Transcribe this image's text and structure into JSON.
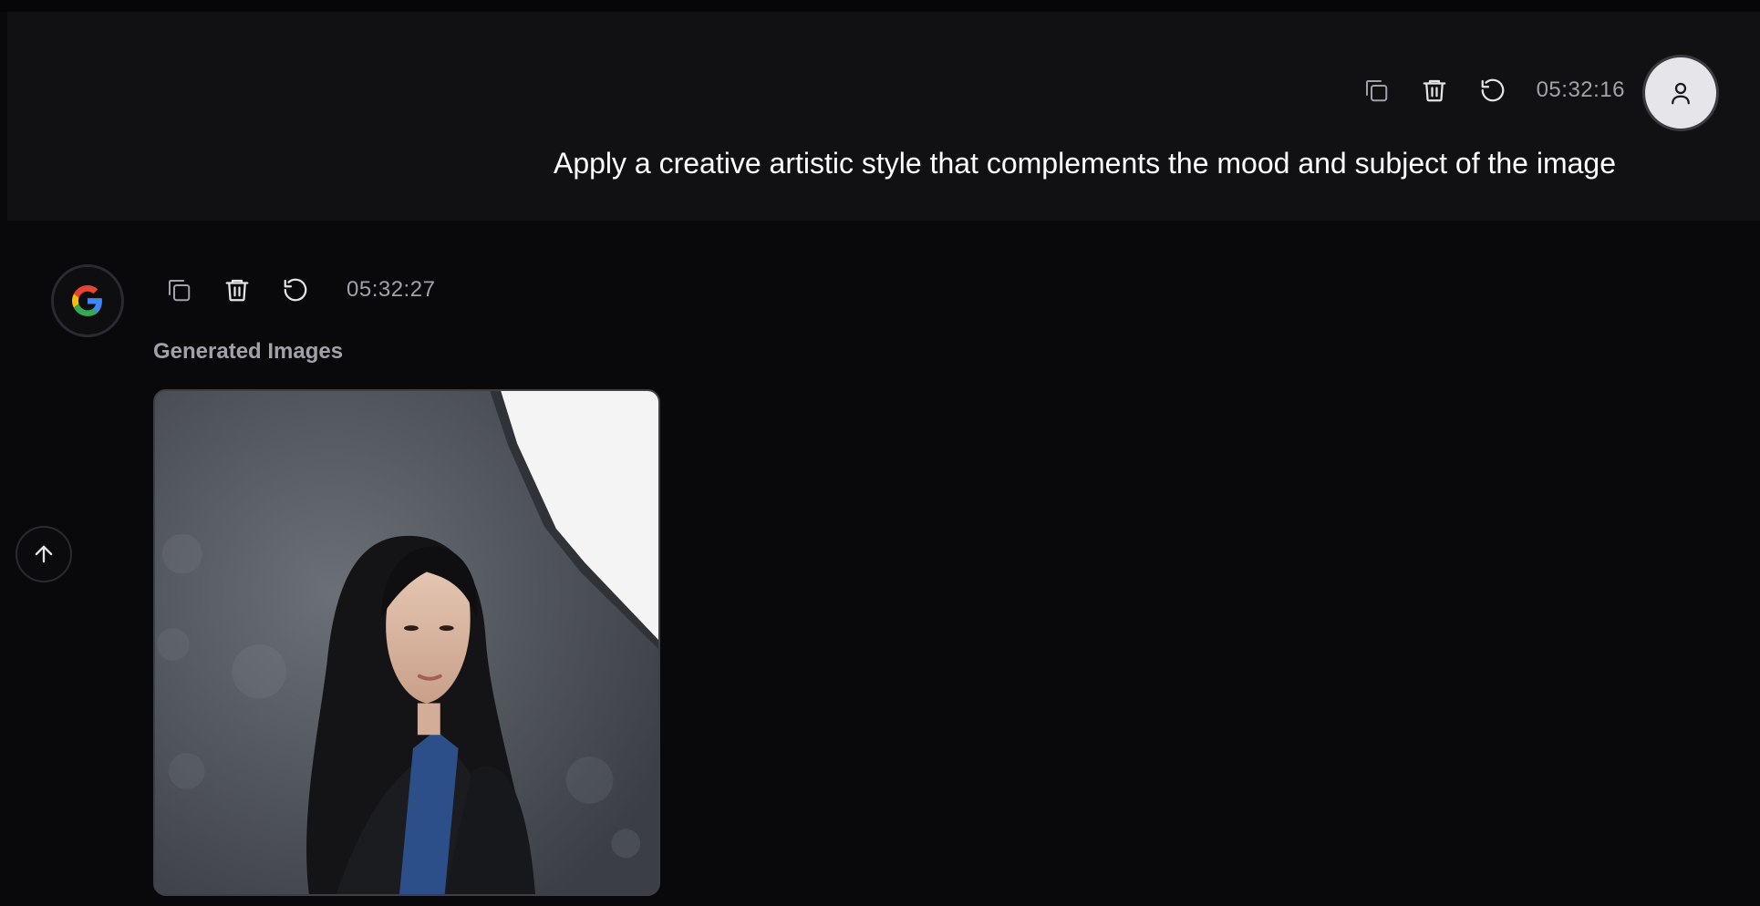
{
  "user_message": {
    "timestamp": "05:32:16",
    "text": "Apply a creative artistic style that complements the mood and subject of the image",
    "actions": [
      "copy-icon",
      "trash-icon",
      "retry-icon"
    ],
    "avatar_icon": "user-icon"
  },
  "assistant_message": {
    "timestamp": "05:32:27",
    "avatar_icon": "google-icon",
    "actions": [
      "copy-icon",
      "trash-icon",
      "retry-icon"
    ],
    "section_label": "Generated Images"
  },
  "scroll_top_icon": "arrow-up-icon",
  "colors": {
    "background": "#09090b",
    "user_bubble": "#111114",
    "muted_text": "#a1a1aa",
    "avatar_light": "#e6e6ea"
  }
}
